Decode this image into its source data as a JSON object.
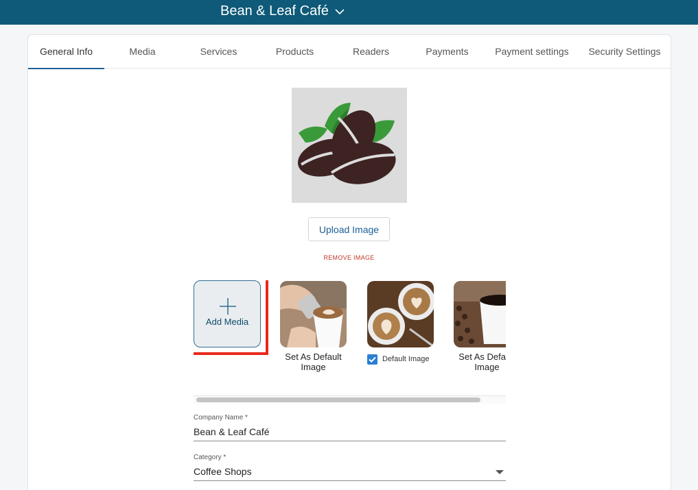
{
  "header": {
    "business_name": "Bean & Leaf Café"
  },
  "tabs": [
    "General Info",
    "Media",
    "Services",
    "Products",
    "Readers",
    "Payments",
    "Payment settings",
    "Security Settings"
  ],
  "active_tab": "General Info",
  "logo": {
    "upload_label": "Upload Image",
    "remove_label": "REMOVE IMAGE"
  },
  "media": {
    "add_label": "Add Media",
    "items": [
      {
        "caption": "Set As Default Image"
      },
      {
        "default_label": "Default Image",
        "is_default": true
      },
      {
        "caption": "Set As Default Image"
      }
    ]
  },
  "form": {
    "company_name_label": "Company Name *",
    "company_name_value": "Bean & Leaf Café",
    "category_label": "Category *",
    "category_value": "Coffee Shops"
  },
  "colors": {
    "header": "#0e5a78",
    "accent": "#1a5f96",
    "danger": "#c0392b",
    "highlight": "#e8281c"
  }
}
